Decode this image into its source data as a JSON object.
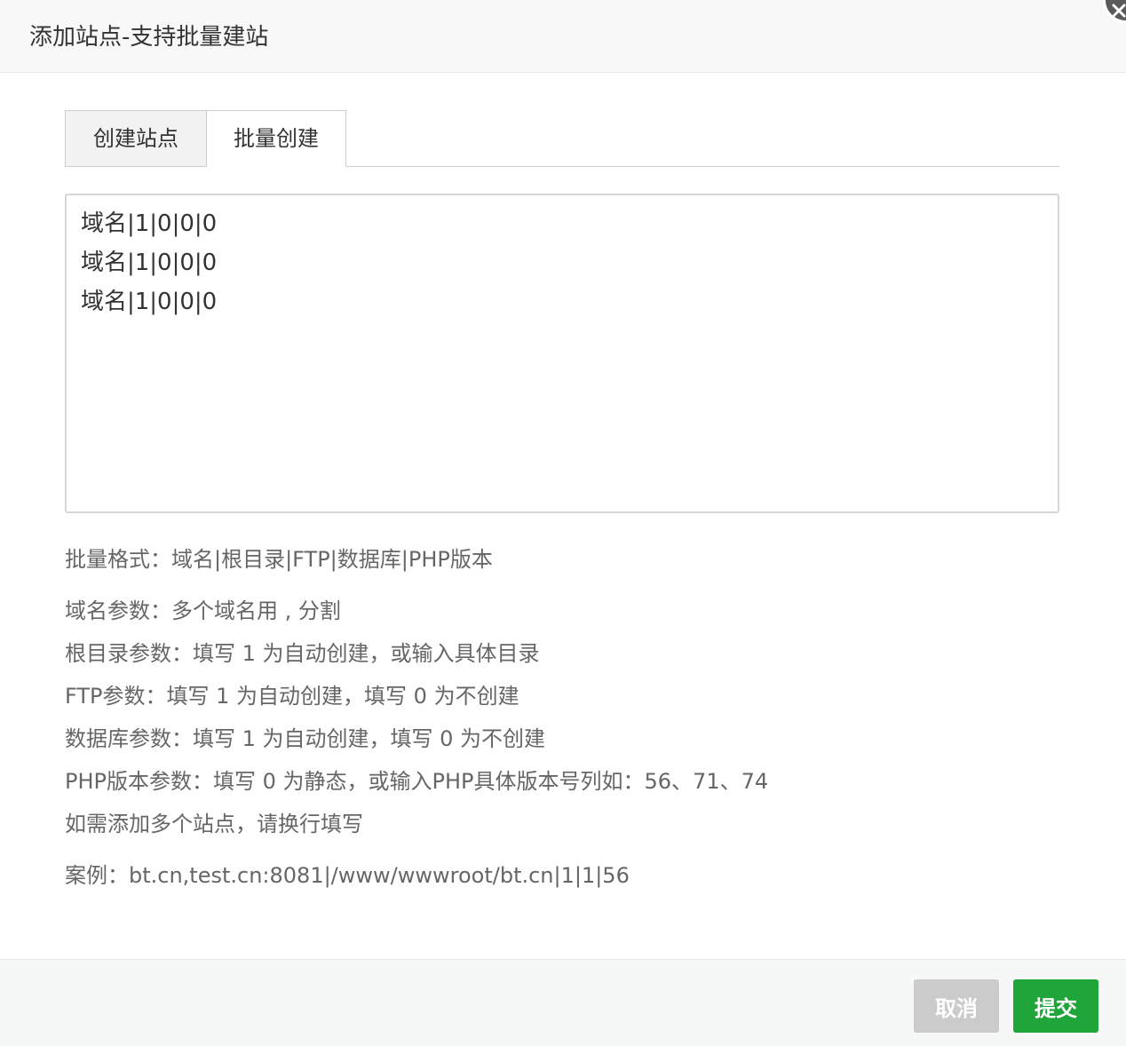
{
  "dialog": {
    "title": "添加站点-支持批量建站"
  },
  "tabs": [
    {
      "label": "创建站点",
      "active": false
    },
    {
      "label": "批量创建",
      "active": true
    }
  ],
  "textarea": {
    "value": "域名|1|0|0|0\n域名|1|0|0|0\n域名|1|0|0|0"
  },
  "help": {
    "format": "批量格式：域名|根目录|FTP|数据库|PHP版本",
    "domain_param": "域名参数：多个域名用 , 分割",
    "root_param": "根目录参数：填写 1 为自动创建，或输入具体目录",
    "ftp_param": "FTP参数：填写 1 为自动创建，填写 0 为不创建",
    "db_param": "数据库参数：填写 1 为自动创建，填写 0 为不创建",
    "php_param": "PHP版本参数：填写 0 为静态，或输入PHP具体版本号列如：56、71、74",
    "multi_sites": "如需添加多个站点，请换行填写",
    "example": "案例：bt.cn,test.cn:8081|/www/wwwroot/bt.cn|1|1|56"
  },
  "footer": {
    "cancel_label": "取消",
    "submit_label": "提交"
  },
  "colors": {
    "submit": "#20a53a",
    "cancel": "#cbcbcb"
  },
  "icons": {
    "close": "close-icon"
  }
}
